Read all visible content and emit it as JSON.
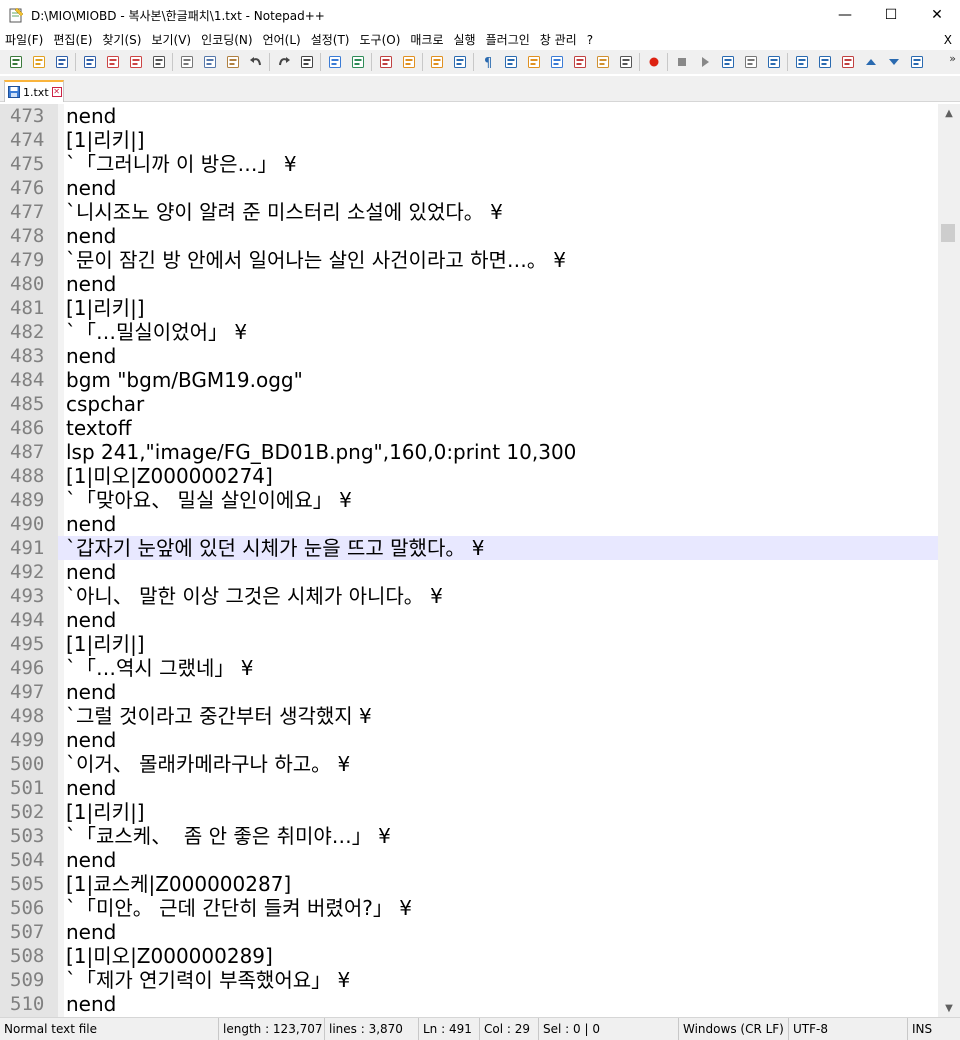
{
  "window": {
    "title": "D:\\MIO\\MIOBD - 복사본\\한글패치\\1.txt - Notepad++",
    "minimize": "—",
    "maximize": "☐",
    "close": "✕"
  },
  "menu": {
    "items": [
      "파일(F)",
      "편집(E)",
      "찾기(S)",
      "보기(V)",
      "인코딩(N)",
      "언어(L)",
      "설정(T)",
      "도구(O)",
      "매크로",
      "실행",
      "플러그인",
      "창 관리",
      "?"
    ],
    "close_label": "X"
  },
  "toolbar": {
    "icons": [
      "new-file-icon",
      "open-file-icon",
      "save-icon",
      "save-all-icon",
      "close-icon",
      "close-all-icon",
      "print-icon",
      "cut-icon",
      "copy-icon",
      "paste-icon",
      "undo-icon",
      "redo-icon",
      "find-icon",
      "replace-icon",
      "zoom-in-icon",
      "zoom-out-icon",
      "sync-vertical-icon",
      "sync-horizontal-icon",
      "word-wrap-icon",
      "show-all-chars-icon",
      "indent-guide-icon",
      "udl-icon",
      "doc-map-icon",
      "function-list-icon",
      "folder-workspace-icon",
      "monitoring-icon",
      "record-macro-icon",
      "stop-record-icon",
      "play-macro-icon",
      "run-macro-multiple-icon",
      "save-macro-icon",
      "plugin-a-icon",
      "plugin-b-icon",
      "plugin-c-icon",
      "plugin-d-icon",
      "plugin-up-icon",
      "plugin-down-icon",
      "plugin-e-icon"
    ],
    "more": "»"
  },
  "tab": {
    "label": "1.txt"
  },
  "editor": {
    "current_line": 491,
    "lines": [
      {
        "n": "473",
        "t": "nend"
      },
      {
        "n": "474",
        "t": "[1|리키|]"
      },
      {
        "n": "475",
        "t": "`「그러니까 이 방은…」 ¥"
      },
      {
        "n": "476",
        "t": "nend"
      },
      {
        "n": "477",
        "t": "`니시조노 양이 알려 준 미스터리 소설에 있었다。 ¥"
      },
      {
        "n": "478",
        "t": "nend"
      },
      {
        "n": "479",
        "t": "`문이 잠긴 방 안에서 일어나는 살인 사건이라고 하면…。 ¥"
      },
      {
        "n": "480",
        "t": "nend"
      },
      {
        "n": "481",
        "t": "[1|리키|]"
      },
      {
        "n": "482",
        "t": "`「…밀실이었어」 ¥"
      },
      {
        "n": "483",
        "t": "nend"
      },
      {
        "n": "484",
        "t": "bgm \"bgm/BGM19.ogg\""
      },
      {
        "n": "485",
        "t": "cspchar"
      },
      {
        "n": "486",
        "t": "textoff"
      },
      {
        "n": "487",
        "t": "lsp 241,\"image/FG_BD01B.png\",160,0:print 10,300"
      },
      {
        "n": "488",
        "t": "[1|미오|Z000000274]"
      },
      {
        "n": "489",
        "t": "`「맞아요、 밀실 살인이에요」 ¥"
      },
      {
        "n": "490",
        "t": "nend"
      },
      {
        "n": "491",
        "t": "`갑자기 눈앞에 있던 시체가 눈을 뜨고 말했다。 ¥"
      },
      {
        "n": "492",
        "t": "nend"
      },
      {
        "n": "493",
        "t": "`아니、 말한 이상 그것은 시체가 아니다。 ¥"
      },
      {
        "n": "494",
        "t": "nend"
      },
      {
        "n": "495",
        "t": "[1|리키|]"
      },
      {
        "n": "496",
        "t": "`「…역시 그랬네」 ¥"
      },
      {
        "n": "497",
        "t": "nend"
      },
      {
        "n": "498",
        "t": "`그럴 것이라고 중간부터 생각했지 ¥"
      },
      {
        "n": "499",
        "t": "nend"
      },
      {
        "n": "500",
        "t": "`이거、 몰래카메라구나 하고。 ¥"
      },
      {
        "n": "501",
        "t": "nend"
      },
      {
        "n": "502",
        "t": "[1|리키|]"
      },
      {
        "n": "503",
        "t": "`「쿄스케、  좀 안 좋은 취미야…」 ¥"
      },
      {
        "n": "504",
        "t": "nend"
      },
      {
        "n": "505",
        "t": "[1|쿄스케|Z000000287]"
      },
      {
        "n": "506",
        "t": "`「미안。 근데 간단히 들켜 버렸어?」 ¥"
      },
      {
        "n": "507",
        "t": "nend"
      },
      {
        "n": "508",
        "t": "[1|미오|Z000000289]"
      },
      {
        "n": "509",
        "t": "`「제가 연기력이 부족했어요」 ¥"
      },
      {
        "n": "510",
        "t": "nend"
      }
    ]
  },
  "status": {
    "type": "Normal text file",
    "length": "length : 123,707",
    "lines": "lines : 3,870",
    "ln": "Ln : 491",
    "col": "Col : 29",
    "sel": "Sel : 0 | 0",
    "eol": "Windows (CR LF)",
    "encoding": "UTF-8",
    "mode": "INS"
  },
  "colors": {
    "current_line": "#e8e8ff",
    "gutter": "#e4e4e4",
    "line_number": "#808080",
    "tab_accent": "#fab43c"
  }
}
